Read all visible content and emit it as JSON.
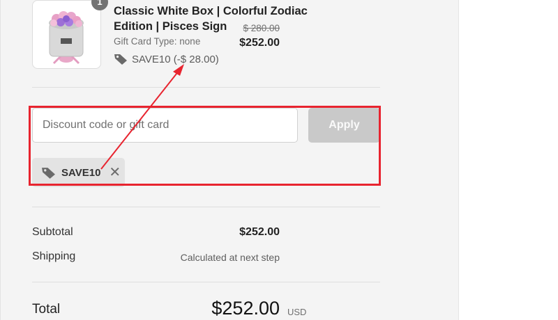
{
  "product": {
    "quantity": "1",
    "title_line1": "Classic White Box | Colorful Zodiac",
    "title_line2": "Edition | Pisces Sign",
    "variant": "Gift Card Type: none",
    "discount_line": "SAVE10 (-$ 28.00)",
    "original_price": "$ 280.00",
    "price": "$252.00",
    "image_icon": "flower-box-image"
  },
  "discount": {
    "placeholder": "Discount code or gift card",
    "apply_label": "Apply",
    "applied_code": "SAVE10",
    "tag_icon": "tag-icon",
    "remove_icon": "close-icon"
  },
  "summary": {
    "subtotal_label": "Subtotal",
    "subtotal_value": "$252.00",
    "shipping_label": "Shipping",
    "shipping_value": "Calculated at next step",
    "total_label": "Total",
    "total_currency": "USD",
    "total_value": "$252.00"
  },
  "colors": {
    "annotation_red": "#e8242f",
    "panel_bg": "#f4f4f4",
    "apply_disabled": "#c9c9c9"
  }
}
